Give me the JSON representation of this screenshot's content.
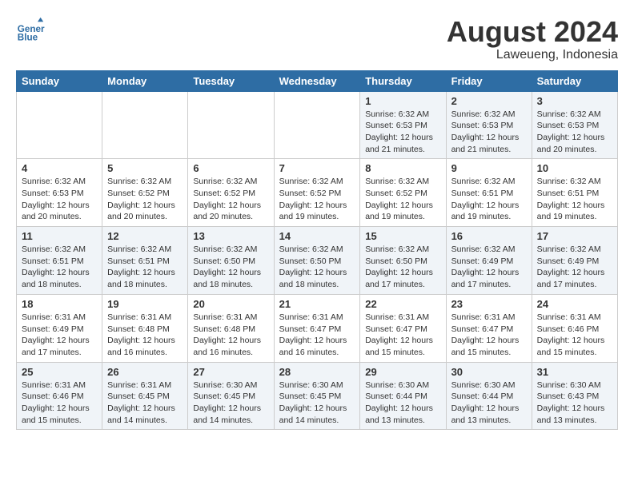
{
  "header": {
    "logo_line1": "General",
    "logo_line2": "Blue",
    "title": "August 2024",
    "subtitle": "Laweueng, Indonesia"
  },
  "days_of_week": [
    "Sunday",
    "Monday",
    "Tuesday",
    "Wednesday",
    "Thursday",
    "Friday",
    "Saturday"
  ],
  "weeks": [
    {
      "cells": [
        {
          "day": "",
          "content": ""
        },
        {
          "day": "",
          "content": ""
        },
        {
          "day": "",
          "content": ""
        },
        {
          "day": "",
          "content": ""
        },
        {
          "day": "1",
          "content": "Sunrise: 6:32 AM\nSunset: 6:53 PM\nDaylight: 12 hours\nand 21 minutes."
        },
        {
          "day": "2",
          "content": "Sunrise: 6:32 AM\nSunset: 6:53 PM\nDaylight: 12 hours\nand 21 minutes."
        },
        {
          "day": "3",
          "content": "Sunrise: 6:32 AM\nSunset: 6:53 PM\nDaylight: 12 hours\nand 20 minutes."
        }
      ]
    },
    {
      "cells": [
        {
          "day": "4",
          "content": "Sunrise: 6:32 AM\nSunset: 6:53 PM\nDaylight: 12 hours\nand 20 minutes."
        },
        {
          "day": "5",
          "content": "Sunrise: 6:32 AM\nSunset: 6:52 PM\nDaylight: 12 hours\nand 20 minutes."
        },
        {
          "day": "6",
          "content": "Sunrise: 6:32 AM\nSunset: 6:52 PM\nDaylight: 12 hours\nand 20 minutes."
        },
        {
          "day": "7",
          "content": "Sunrise: 6:32 AM\nSunset: 6:52 PM\nDaylight: 12 hours\nand 19 minutes."
        },
        {
          "day": "8",
          "content": "Sunrise: 6:32 AM\nSunset: 6:52 PM\nDaylight: 12 hours\nand 19 minutes."
        },
        {
          "day": "9",
          "content": "Sunrise: 6:32 AM\nSunset: 6:51 PM\nDaylight: 12 hours\nand 19 minutes."
        },
        {
          "day": "10",
          "content": "Sunrise: 6:32 AM\nSunset: 6:51 PM\nDaylight: 12 hours\nand 19 minutes."
        }
      ]
    },
    {
      "cells": [
        {
          "day": "11",
          "content": "Sunrise: 6:32 AM\nSunset: 6:51 PM\nDaylight: 12 hours\nand 18 minutes."
        },
        {
          "day": "12",
          "content": "Sunrise: 6:32 AM\nSunset: 6:51 PM\nDaylight: 12 hours\nand 18 minutes."
        },
        {
          "day": "13",
          "content": "Sunrise: 6:32 AM\nSunset: 6:50 PM\nDaylight: 12 hours\nand 18 minutes."
        },
        {
          "day": "14",
          "content": "Sunrise: 6:32 AM\nSunset: 6:50 PM\nDaylight: 12 hours\nand 18 minutes."
        },
        {
          "day": "15",
          "content": "Sunrise: 6:32 AM\nSunset: 6:50 PM\nDaylight: 12 hours\nand 17 minutes."
        },
        {
          "day": "16",
          "content": "Sunrise: 6:32 AM\nSunset: 6:49 PM\nDaylight: 12 hours\nand 17 minutes."
        },
        {
          "day": "17",
          "content": "Sunrise: 6:32 AM\nSunset: 6:49 PM\nDaylight: 12 hours\nand 17 minutes."
        }
      ]
    },
    {
      "cells": [
        {
          "day": "18",
          "content": "Sunrise: 6:31 AM\nSunset: 6:49 PM\nDaylight: 12 hours\nand 17 minutes."
        },
        {
          "day": "19",
          "content": "Sunrise: 6:31 AM\nSunset: 6:48 PM\nDaylight: 12 hours\nand 16 minutes."
        },
        {
          "day": "20",
          "content": "Sunrise: 6:31 AM\nSunset: 6:48 PM\nDaylight: 12 hours\nand 16 minutes."
        },
        {
          "day": "21",
          "content": "Sunrise: 6:31 AM\nSunset: 6:47 PM\nDaylight: 12 hours\nand 16 minutes."
        },
        {
          "day": "22",
          "content": "Sunrise: 6:31 AM\nSunset: 6:47 PM\nDaylight: 12 hours\nand 15 minutes."
        },
        {
          "day": "23",
          "content": "Sunrise: 6:31 AM\nSunset: 6:47 PM\nDaylight: 12 hours\nand 15 minutes."
        },
        {
          "day": "24",
          "content": "Sunrise: 6:31 AM\nSunset: 6:46 PM\nDaylight: 12 hours\nand 15 minutes."
        }
      ]
    },
    {
      "cells": [
        {
          "day": "25",
          "content": "Sunrise: 6:31 AM\nSunset: 6:46 PM\nDaylight: 12 hours\nand 15 minutes."
        },
        {
          "day": "26",
          "content": "Sunrise: 6:31 AM\nSunset: 6:45 PM\nDaylight: 12 hours\nand 14 minutes."
        },
        {
          "day": "27",
          "content": "Sunrise: 6:30 AM\nSunset: 6:45 PM\nDaylight: 12 hours\nand 14 minutes."
        },
        {
          "day": "28",
          "content": "Sunrise: 6:30 AM\nSunset: 6:45 PM\nDaylight: 12 hours\nand 14 minutes."
        },
        {
          "day": "29",
          "content": "Sunrise: 6:30 AM\nSunset: 6:44 PM\nDaylight: 12 hours\nand 13 minutes."
        },
        {
          "day": "30",
          "content": "Sunrise: 6:30 AM\nSunset: 6:44 PM\nDaylight: 12 hours\nand 13 minutes."
        },
        {
          "day": "31",
          "content": "Sunrise: 6:30 AM\nSunset: 6:43 PM\nDaylight: 12 hours\nand 13 minutes."
        }
      ]
    }
  ]
}
